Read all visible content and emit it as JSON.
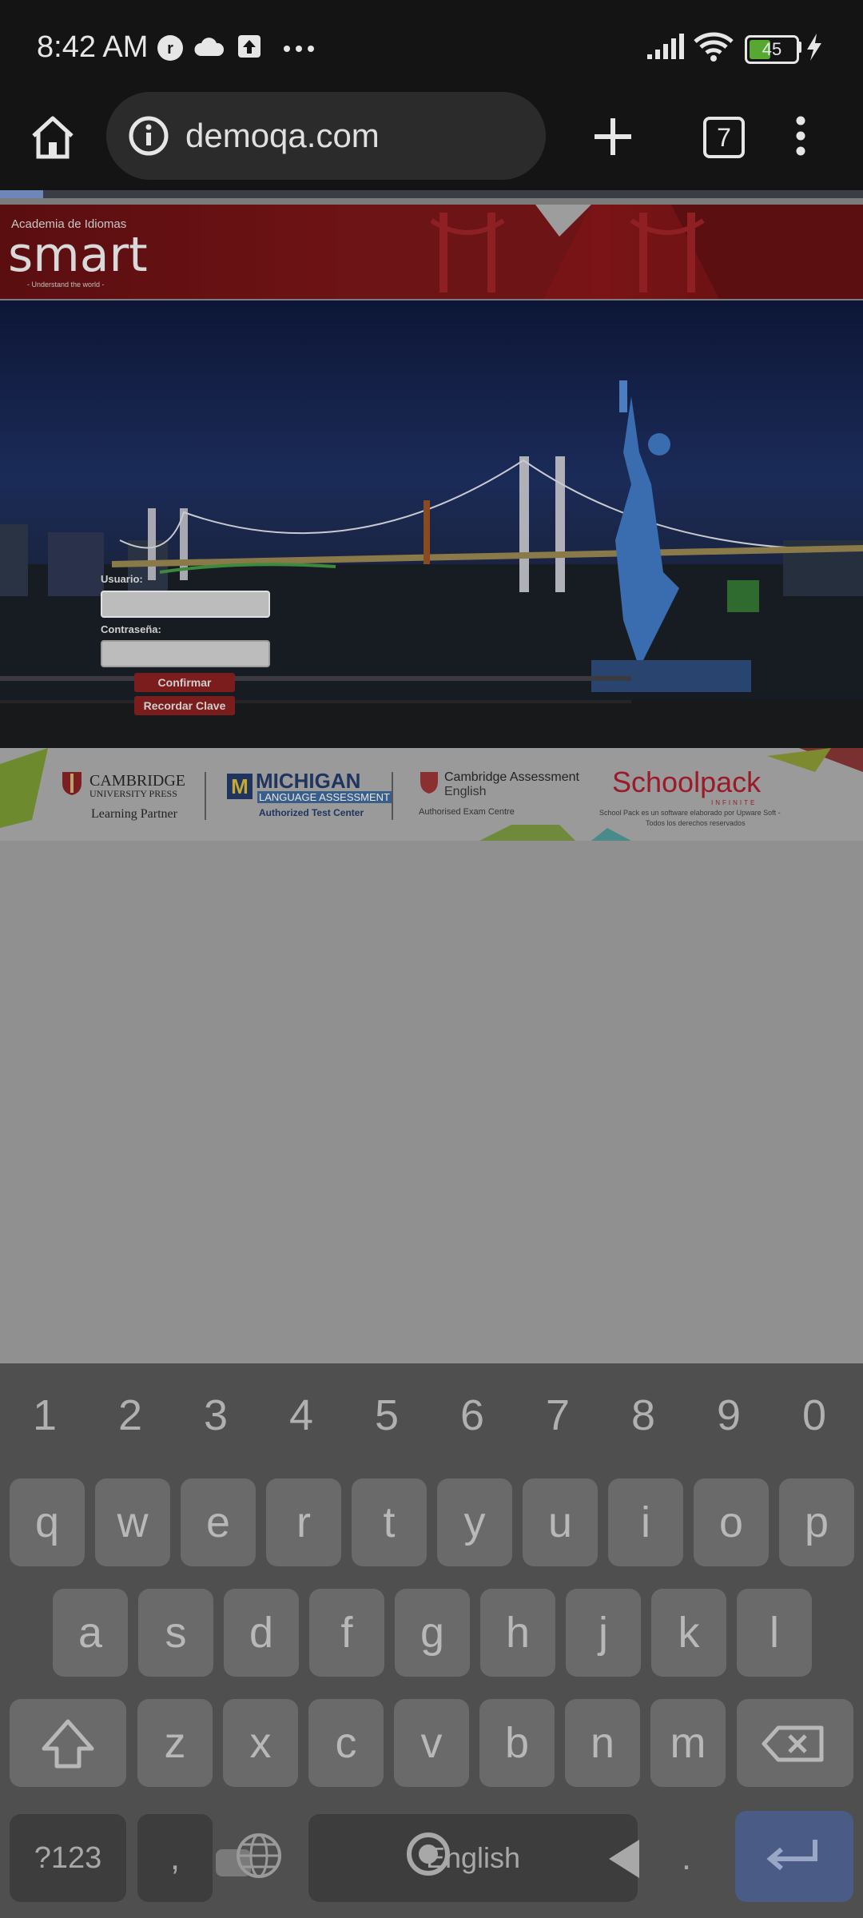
{
  "status_bar": {
    "time": "8:42 AM",
    "battery_level": "45",
    "icons": [
      "opera-icon",
      "cloud-icon",
      "upload-icon",
      "more-dots-icon",
      "signal-icon",
      "wifi-icon",
      "battery-icon",
      "charging-icon"
    ]
  },
  "browser": {
    "url": "demoqa.com",
    "tab_count": "7",
    "load_progress": 0.05
  },
  "page": {
    "banner": {
      "tagline": "Academia de Idiomas",
      "brand": "smart",
      "slogan": "- Understand the world -"
    },
    "login": {
      "username_label": "Usuario:",
      "password_label": "Contraseña:",
      "confirm_button": "Confirmar",
      "remember_button": "Recordar Clave"
    },
    "footer": {
      "cambridge_name": "CAMBRIDGE",
      "cambridge_press": "UNIVERSITY PRESS",
      "cambridge_partner": "Learning Partner",
      "michigan_name": "MICHIGAN",
      "michigan_sub": "LANGUAGE ASSESSMENT",
      "michigan_center": "Authorized Test Center",
      "assessment_name": "Cambridge Assessment",
      "assessment_sub": "English",
      "assessment_centre": "Authorised Exam Centre",
      "schoolpack": "Schoolpack",
      "schoolpack_sub": "INFINITE",
      "schoolpack_note1": "School Pack es un software elaborado por Upware Soft -",
      "schoolpack_note2": "Todos los derechos reservados"
    }
  },
  "keyboard": {
    "numbers": [
      "1",
      "2",
      "3",
      "4",
      "5",
      "6",
      "7",
      "8",
      "9",
      "0"
    ],
    "row1": [
      "q",
      "w",
      "e",
      "r",
      "t",
      "y",
      "u",
      "i",
      "o",
      "p"
    ],
    "row2": [
      "a",
      "s",
      "d",
      "f",
      "g",
      "h",
      "j",
      "k",
      "l"
    ],
    "row3": [
      "z",
      "x",
      "c",
      "v",
      "b",
      "n",
      "m"
    ],
    "symbols_key": "?123",
    "comma_key": ",",
    "space_label": "English",
    "period_key": "."
  },
  "colors": {
    "banner_red": "#6b1214",
    "button_red": "#7c1d1d",
    "enter_blue": "#4a5b86"
  }
}
